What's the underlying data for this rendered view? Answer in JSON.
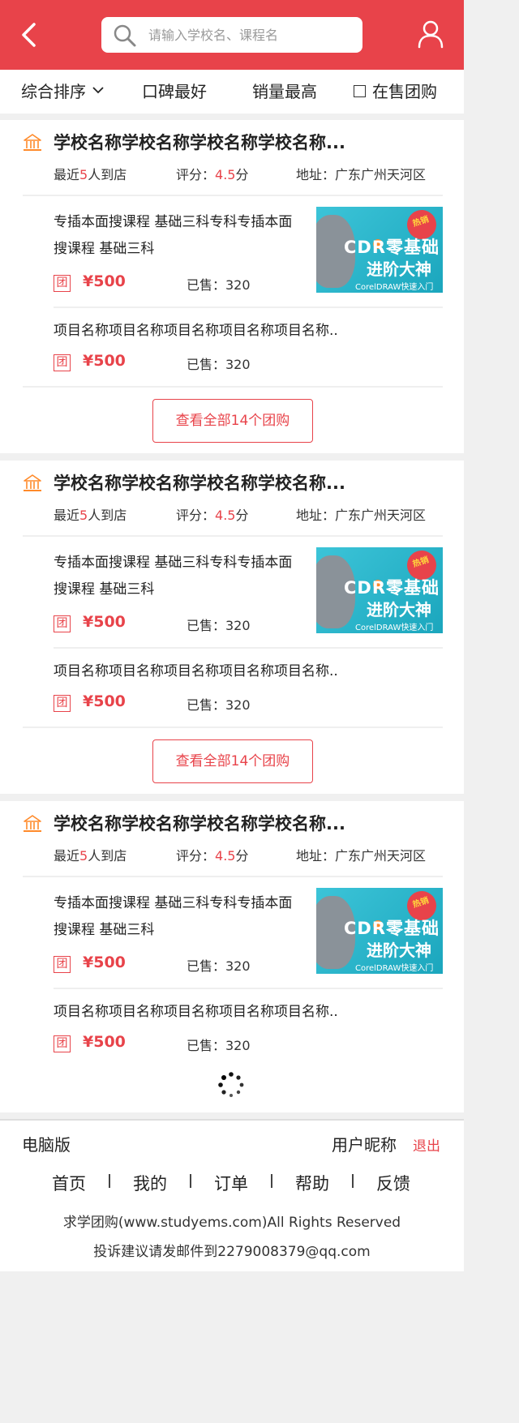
{
  "header": {
    "search_placeholder": "请输入学校名、课程名"
  },
  "sortbar": {
    "items": [
      "综合排序",
      "口碑最好",
      "销量最高",
      "在售团购"
    ]
  },
  "colors": {
    "accent": "#e8434a",
    "thumb": "#2bb6cb"
  },
  "schools": [
    {
      "name": "学校名称学校名称学校名称学校名称...",
      "recent_prefix": "最近",
      "recent_count": "5",
      "recent_suffix": "人到店",
      "rating_label": "评分：",
      "rating_value": "4.5",
      "rating_unit": "分",
      "address": "地址：广东广州天河区",
      "courses": [
        {
          "title": "专插本面搜课程 基础三科专科专插本面搜课程  基础三科",
          "tag": "团",
          "price": "¥500",
          "sold": "已售：320",
          "thumb": {
            "hot": "热销",
            "line1": "CDR零基础",
            "line2": "进阶大神",
            "line3": "CorelDRAW快速入门"
          }
        },
        {
          "title": "项目名称项目名称项目名称项目名称项目名称..",
          "tag": "团",
          "price": "¥500",
          "sold": "已售：320"
        }
      ],
      "view_all": "查看全部14个团购"
    },
    {
      "name": "学校名称学校名称学校名称学校名称...",
      "recent_prefix": "最近",
      "recent_count": "5",
      "recent_suffix": "人到店",
      "rating_label": "评分：",
      "rating_value": "4.5",
      "rating_unit": "分",
      "address": "地址：广东广州天河区",
      "courses": [
        {
          "title": "专插本面搜课程 基础三科专科专插本面搜课程  基础三科",
          "tag": "团",
          "price": "¥500",
          "sold": "已售：320",
          "thumb": {
            "hot": "热销",
            "line1": "CDR零基础",
            "line2": "进阶大神",
            "line3": "CorelDRAW快速入门"
          }
        },
        {
          "title": "项目名称项目名称项目名称项目名称项目名称..",
          "tag": "团",
          "price": "¥500",
          "sold": "已售：320"
        }
      ],
      "view_all": "查看全部14个团购"
    },
    {
      "name": "学校名称学校名称学校名称学校名称...",
      "recent_prefix": "最近",
      "recent_count": "5",
      "recent_suffix": "人到店",
      "rating_label": "评分：",
      "rating_value": "4.5",
      "rating_unit": "分",
      "address": "地址：广东广州天河区",
      "courses": [
        {
          "title": "专插本面搜课程 基础三科专科专插本面搜课程  基础三科",
          "tag": "团",
          "price": "¥500",
          "sold": "已售：320",
          "thumb": {
            "hot": "热销",
            "line1": "CDR零基础",
            "line2": "进阶大神",
            "line3": "CorelDRAW快速入门"
          }
        },
        {
          "title": "项目名称项目名称项目名称项目名称项目名称..",
          "tag": "团",
          "price": "¥500",
          "sold": "已售：320"
        }
      ]
    }
  ],
  "footer": {
    "pc_version": "电脑版",
    "nickname": "用户昵称",
    "logout": "退出",
    "nav": [
      "首页",
      "我的",
      "订单",
      "帮助",
      "反馈"
    ],
    "copyright": "求学团购(www.studyems.com)All Rights Reserved",
    "contact": "投诉建议请发邮件到2279008379@qq.com"
  }
}
